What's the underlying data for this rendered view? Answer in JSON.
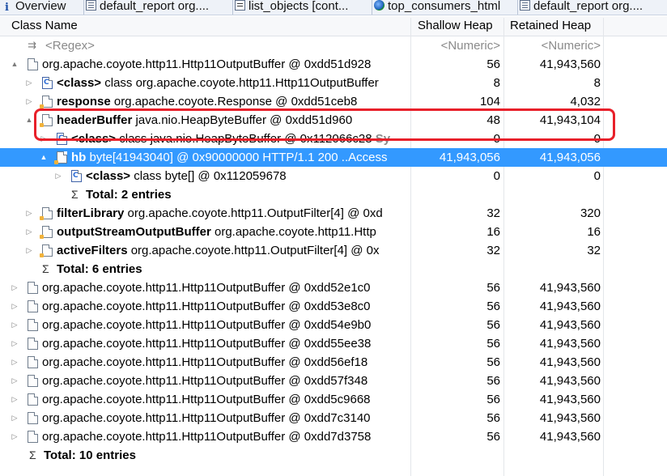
{
  "tabs": [
    {
      "icon": "info-icon",
      "label": "Overview"
    },
    {
      "icon": "report-icon",
      "label": "default_report  org...."
    },
    {
      "icon": "query-icon",
      "label": "list_objects  [cont..."
    },
    {
      "icon": "globe-icon",
      "label": "top_consumers_html"
    },
    {
      "icon": "report-icon",
      "label": "default_report  org...."
    }
  ],
  "columns": {
    "name": "Class Name",
    "shallow": "Shallow Heap",
    "retained": "Retained Heap"
  },
  "filter": {
    "name": "<Regex>",
    "shallow": "<Numeric>",
    "retained": "<Numeric>"
  },
  "rows": [
    {
      "level": 0,
      "arrow": "▲",
      "icon": "file-icon",
      "bold": "",
      "text": "org.apache.coyote.http11.Http11OutputBuffer @ 0xdd51d928",
      "gray": "",
      "shallow": "56",
      "retained": "41,943,560"
    },
    {
      "level": 1,
      "arrow": "▷",
      "icon": "class-icon",
      "bold": "<class>",
      "text": " class org.apache.coyote.http11.Http11OutputBuffer",
      "gray": "",
      "shallow": "8",
      "retained": "8"
    },
    {
      "level": 1,
      "arrow": "▷",
      "icon": "field-icon",
      "bold": "response",
      "text": " org.apache.coyote.Response @ 0xdd51ceb8",
      "gray": "",
      "shallow": "104",
      "retained": "4,032"
    },
    {
      "level": 1,
      "arrow": "▲",
      "icon": "field-icon",
      "bold": "headerBuffer",
      "text": " java.nio.HeapByteBuffer @ 0xdd51d960",
      "gray": "",
      "shallow": "48",
      "retained": "41,943,104"
    },
    {
      "level": 2,
      "arrow": "▷",
      "icon": "class-icon",
      "bold": "<class>",
      "text": " class java.nio.HeapByteBuffer @ 0x112066c28",
      "gray": " Sy",
      "shallow": "0",
      "retained": "0"
    },
    {
      "level": 2,
      "arrow": "▲",
      "icon": "field-icon",
      "bold": "hb",
      "text": " byte[41943040] @ 0x90000000  HTTP/1.1 200 ..Access",
      "gray": "",
      "shallow": "41,943,056",
      "retained": "41,943,056",
      "selected": true
    },
    {
      "level": 3,
      "arrow": "▷",
      "icon": "class-icon",
      "bold": "<class>",
      "text": " class byte[] @ 0x112059678",
      "gray": "",
      "shallow": "0",
      "retained": "0"
    },
    {
      "level": 3,
      "arrow": "",
      "icon": "sigma-icon",
      "bold": "Total: 2 entries",
      "text": "",
      "gray": "",
      "shallow": "",
      "retained": ""
    },
    {
      "level": 1,
      "arrow": "▷",
      "icon": "field-icon",
      "bold": "filterLibrary",
      "text": " org.apache.coyote.http11.OutputFilter[4] @ 0xd",
      "gray": "",
      "shallow": "32",
      "retained": "320"
    },
    {
      "level": 1,
      "arrow": "▷",
      "icon": "field-icon",
      "bold": "outputStreamOutputBuffer",
      "text": " org.apache.coyote.http11.Http",
      "gray": "",
      "shallow": "16",
      "retained": "16"
    },
    {
      "level": 1,
      "arrow": "▷",
      "icon": "field-icon",
      "bold": "activeFilters",
      "text": " org.apache.coyote.http11.OutputFilter[4] @ 0x",
      "gray": "",
      "shallow": "32",
      "retained": "32"
    },
    {
      "level": 1,
      "arrow": "",
      "icon": "sigma-icon",
      "bold": "Total: 6 entries",
      "text": "",
      "gray": "",
      "shallow": "",
      "retained": ""
    },
    {
      "level": 0,
      "arrow": "▷",
      "icon": "file-icon",
      "bold": "",
      "text": "org.apache.coyote.http11.Http11OutputBuffer @ 0xdd52e1c0",
      "gray": "",
      "shallow": "56",
      "retained": "41,943,560"
    },
    {
      "level": 0,
      "arrow": "▷",
      "icon": "file-icon",
      "bold": "",
      "text": "org.apache.coyote.http11.Http11OutputBuffer @ 0xdd53e8c0",
      "gray": "",
      "shallow": "56",
      "retained": "41,943,560"
    },
    {
      "level": 0,
      "arrow": "▷",
      "icon": "file-icon",
      "bold": "",
      "text": "org.apache.coyote.http11.Http11OutputBuffer @ 0xdd54e9b0",
      "gray": "",
      "shallow": "56",
      "retained": "41,943,560"
    },
    {
      "level": 0,
      "arrow": "▷",
      "icon": "file-icon",
      "bold": "",
      "text": "org.apache.coyote.http11.Http11OutputBuffer @ 0xdd55ee38",
      "gray": "",
      "shallow": "56",
      "retained": "41,943,560"
    },
    {
      "level": 0,
      "arrow": "▷",
      "icon": "file-icon",
      "bold": "",
      "text": "org.apache.coyote.http11.Http11OutputBuffer @ 0xdd56ef18",
      "gray": "",
      "shallow": "56",
      "retained": "41,943,560"
    },
    {
      "level": 0,
      "arrow": "▷",
      "icon": "file-icon",
      "bold": "",
      "text": "org.apache.coyote.http11.Http11OutputBuffer @ 0xdd57f348",
      "gray": "",
      "shallow": "56",
      "retained": "41,943,560"
    },
    {
      "level": 0,
      "arrow": "▷",
      "icon": "file-icon",
      "bold": "",
      "text": "org.apache.coyote.http11.Http11OutputBuffer @ 0xdd5c9668",
      "gray": "",
      "shallow": "56",
      "retained": "41,943,560"
    },
    {
      "level": 0,
      "arrow": "▷",
      "icon": "file-icon",
      "bold": "",
      "text": "org.apache.coyote.http11.Http11OutputBuffer @ 0xdd7c3140",
      "gray": "",
      "shallow": "56",
      "retained": "41,943,560"
    },
    {
      "level": 0,
      "arrow": "▷",
      "icon": "file-icon",
      "bold": "",
      "text": "org.apache.coyote.http11.Http11OutputBuffer @ 0xdd7d3758",
      "gray": "",
      "shallow": "56",
      "retained": "41,943,560"
    },
    {
      "level": -1,
      "arrow": "",
      "icon": "sigma-icon",
      "bold": "Total: 10 entries",
      "text": "",
      "gray": "",
      "shallow": "",
      "retained": ""
    }
  ],
  "highlight_color": "#e8202a",
  "selection_color": "#3399ff"
}
